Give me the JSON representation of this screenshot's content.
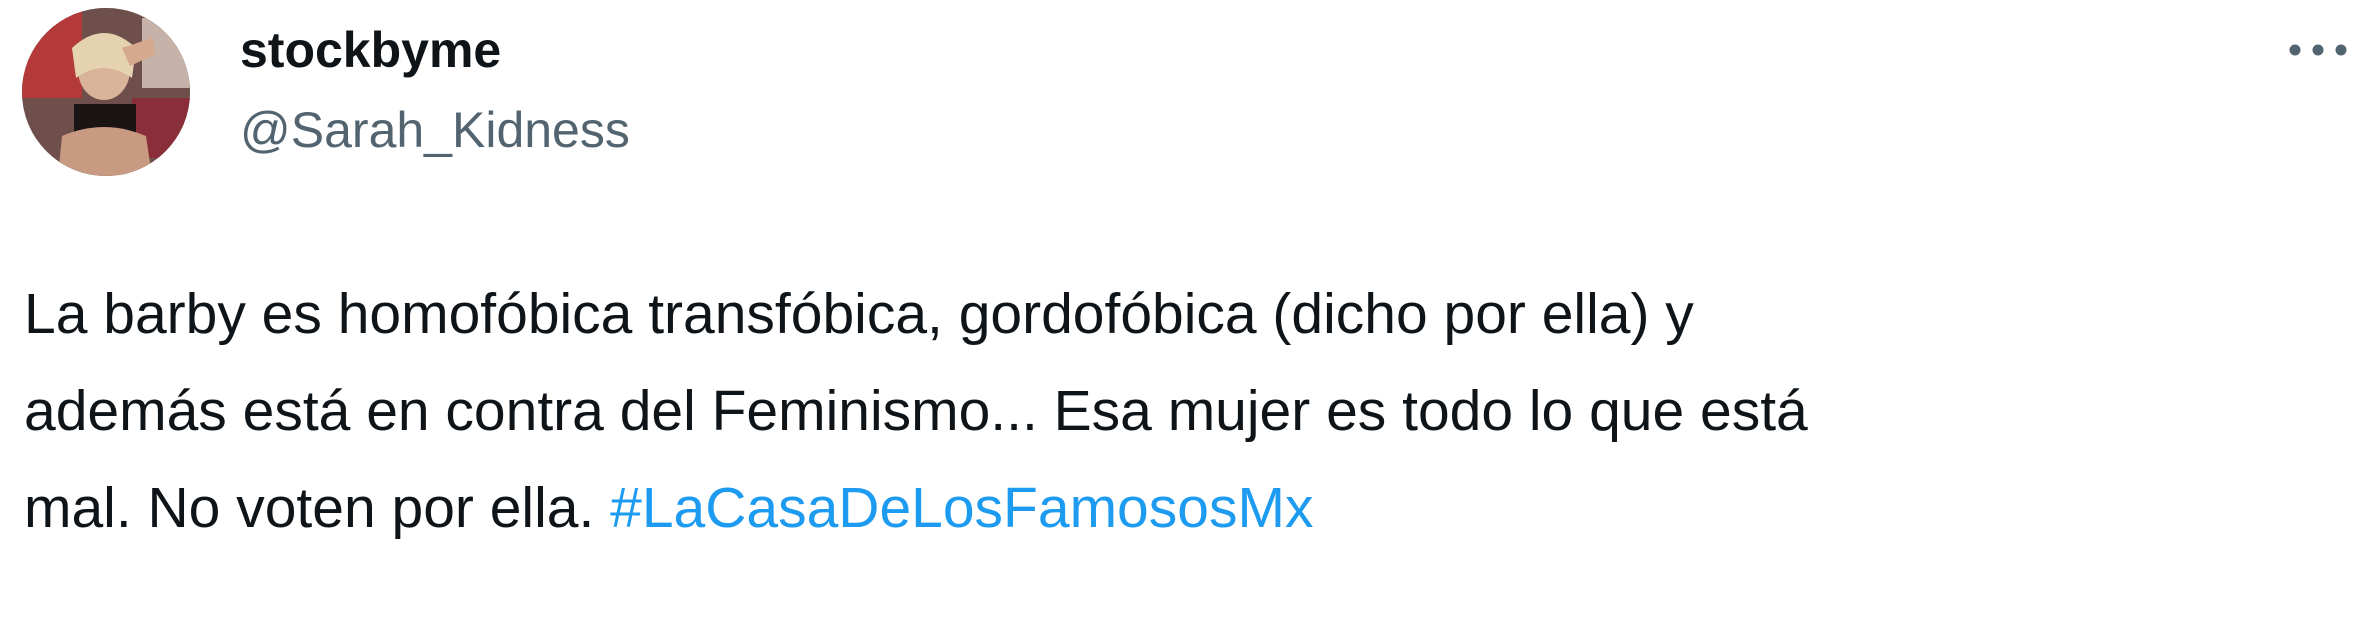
{
  "author": {
    "display_name": "stockbyme",
    "handle": "@Sarah_Kidness",
    "avatar_icon": "profile-photo"
  },
  "menu": {
    "icon": "more-options-icon"
  },
  "tweet": {
    "lines": [
      "La barby es homofóbica transfóbica, gordofóbica (dicho por ella) y",
      "además está en contra del Feminismo... Esa mujer es todo lo que está",
      "mal. No voten por ella. "
    ],
    "hashtag": "#LaCasaDeLosFamososMx"
  },
  "colors": {
    "text": "#0f1419",
    "secondary": "#536471",
    "link": "#1d9bf0"
  }
}
